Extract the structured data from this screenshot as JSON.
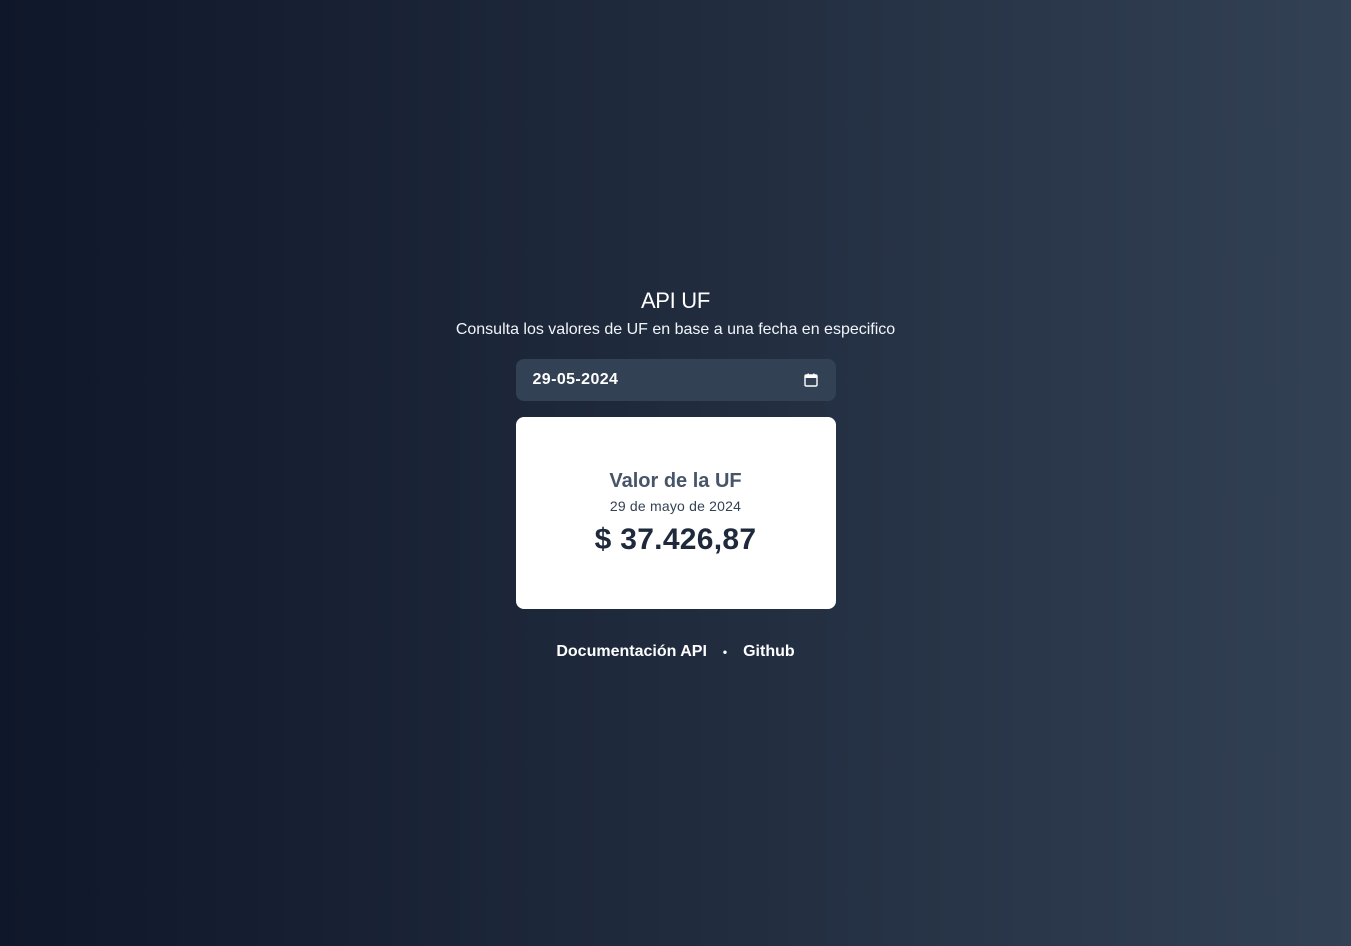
{
  "header": {
    "title": "API UF",
    "subtitle": "Consulta los valores de UF en base a una fecha en especifico"
  },
  "date_input": {
    "value": "29-05-2024",
    "icon": "calendar-icon"
  },
  "card": {
    "title": "Valor de la UF",
    "date_label": "29 de mayo de 2024",
    "value": "$ 37.426,87"
  },
  "footer": {
    "links": [
      {
        "label": "Documentación API"
      },
      {
        "label": "Github"
      }
    ],
    "separator": "•"
  },
  "colors": {
    "background_start": "#0f172a",
    "background_end": "#334155",
    "input_bg": "#334155",
    "card_bg": "#ffffff",
    "card_title": "#475569",
    "card_value": "#1e293b"
  }
}
